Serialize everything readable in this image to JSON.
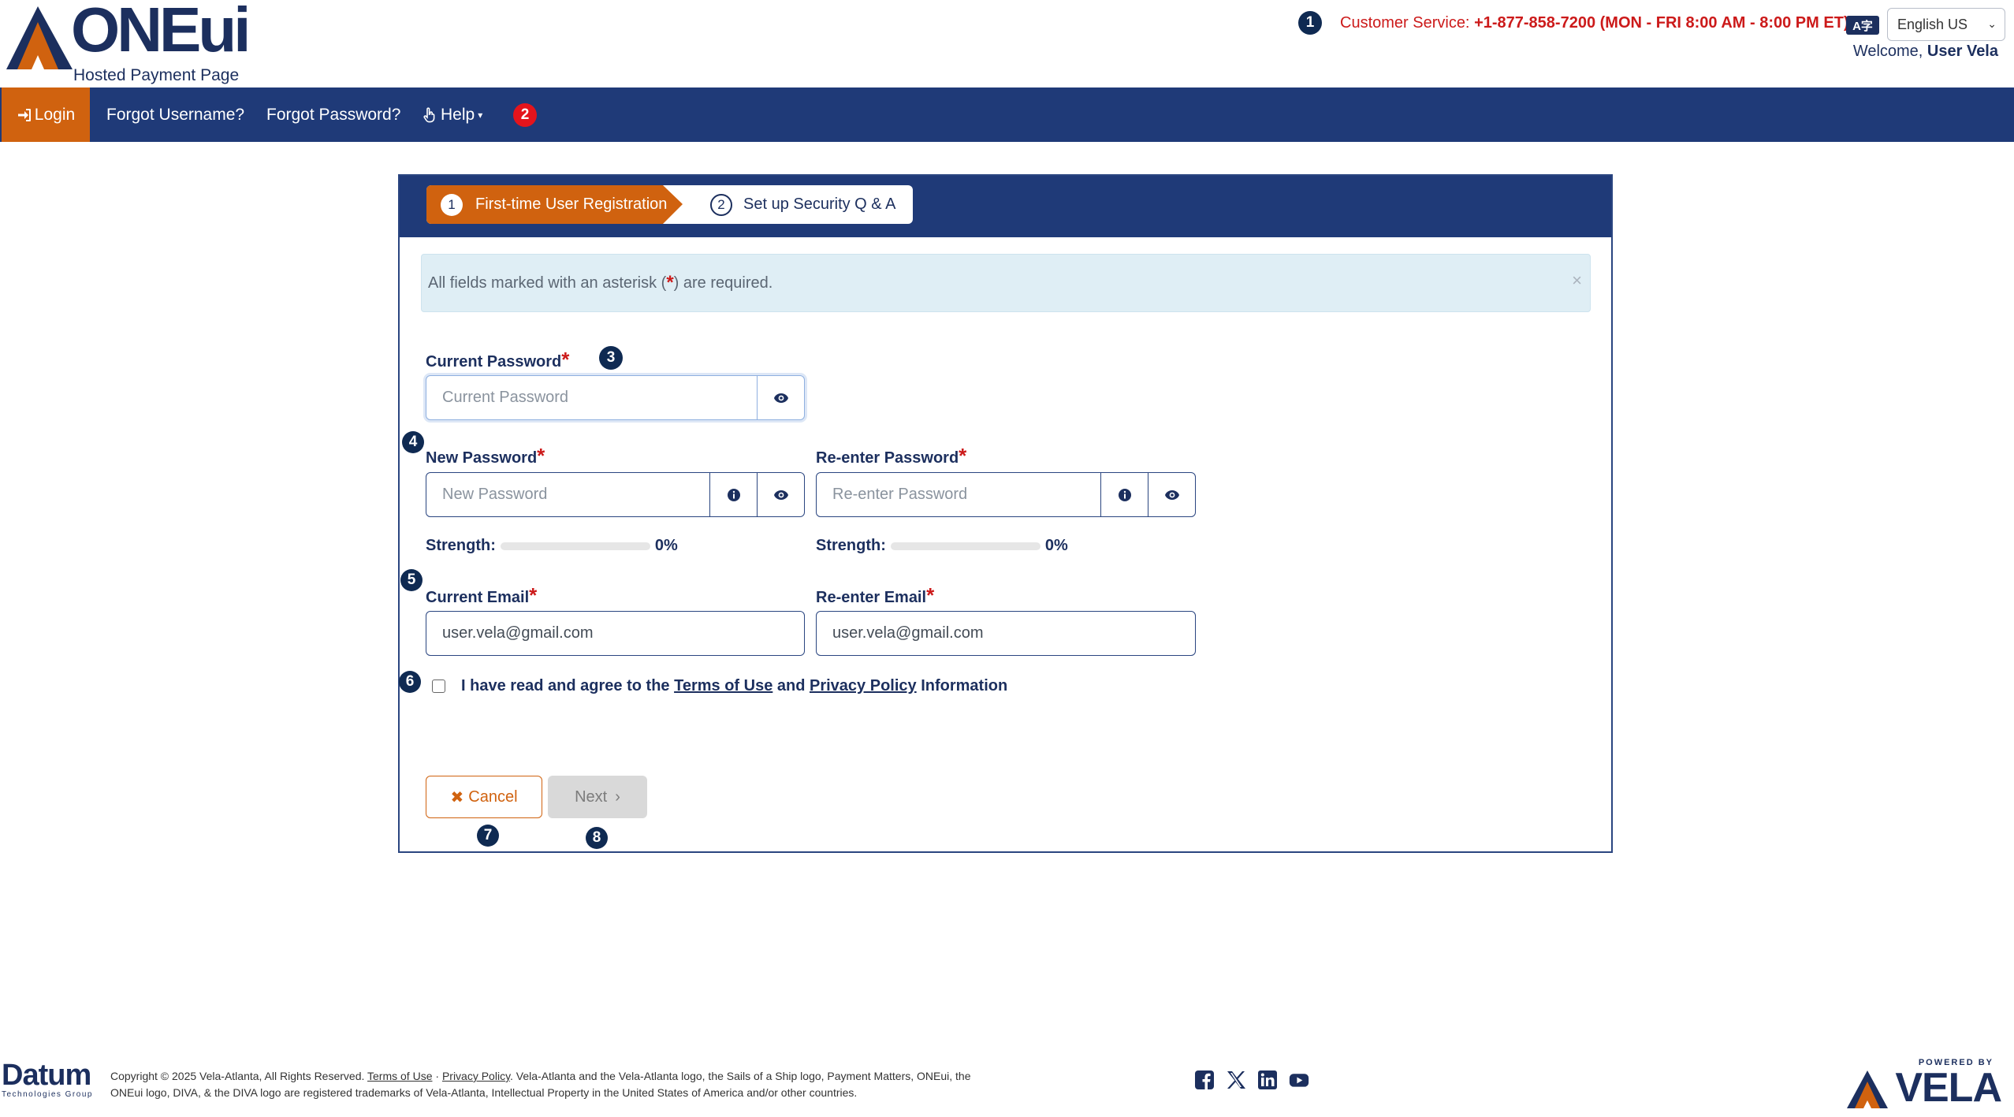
{
  "header": {
    "brand": "ONEui",
    "subtitle": "Hosted Payment Page",
    "cs_prefix": "Customer Service: ",
    "cs_details": "+1-877-858-7200 (MON - FRI 8:00 AM - 8:00 PM ET)",
    "language_icon": "A字",
    "language": "English US",
    "welcome_prefix": "Welcome,",
    "user": "User Vela"
  },
  "nav": {
    "login": "Login",
    "forgot_username": "Forgot Username?",
    "forgot_password": "Forgot Password?",
    "help": "Help"
  },
  "badges": [
    "1",
    "2",
    "3",
    "4",
    "5",
    "6",
    "7",
    "8"
  ],
  "steps": {
    "step1_num": "1",
    "step1_label": "First-time User Registration",
    "step2_num": "2",
    "step2_label": "Set up Security Q & A"
  },
  "alert": {
    "text_before": "All fields marked with an asterisk (",
    "asterisk": "*",
    "text_after": ") are required.",
    "close": "×"
  },
  "form": {
    "current_password_label": "Current Password",
    "current_password_placeholder": "Current Password",
    "new_password_label": "New Password",
    "new_password_placeholder": "New Password",
    "reenter_password_label": "Re-enter Password",
    "reenter_password_placeholder": "Re-enter Password",
    "strength_label": "Strength:",
    "new_strength_value": "0%",
    "reenter_strength_value": "0%",
    "new_strength_fraction": 0,
    "reenter_strength_fraction": 0,
    "current_email_label": "Current Email",
    "current_email_value": "user.vela@gmail.com",
    "reenter_email_label": "Re-enter Email",
    "reenter_email_value": "user.vela@gmail.com",
    "required_mark": "*",
    "agree_prefix": "I have read and agree to the ",
    "terms_link": "Terms of Use",
    "agree_and": " and ",
    "privacy_link": "Privacy Policy",
    "agree_suffix": " Information",
    "agree_checked": false
  },
  "buttons": {
    "cancel": "Cancel",
    "next": "Next"
  },
  "footer": {
    "datum": "Datum",
    "datum_sub": "Technologies Group",
    "copyright_prefix": "Copyright © 2025 Vela-Atlanta, All Rights Reserved. ",
    "terms": "Terms of Use",
    "separator": " · ",
    "privacy": "Privacy Policy",
    "copyright_suffix": ". Vela-Atlanta and the Vela-Atlanta logo, the Sails of a Ship logo, Payment Matters, ONEui, the ONEui logo, DIVA, & the DIVA logo are registered trademarks of Vela-Atlanta, Intellectual Property in the United States of America and/or other countries.",
    "powered_by": "POWERED BY",
    "vela": "VELA",
    "social": [
      "facebook-icon",
      "x-icon",
      "linkedin-icon",
      "youtube-icon"
    ]
  },
  "colors": {
    "navy": "#1f3a78",
    "orange": "#d0620f",
    "red": "#cc1a1a",
    "badge": "#0f2a52"
  }
}
